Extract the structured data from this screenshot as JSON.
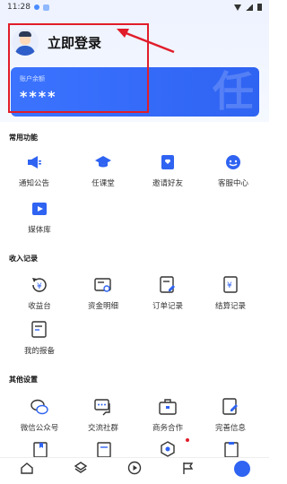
{
  "status_bar": {
    "time": "11:28"
  },
  "profile": {
    "login_label": "立即登录"
  },
  "balance": {
    "label": "账户余额",
    "value": "****",
    "watermark": "任"
  },
  "sections": {
    "common": {
      "title": "常用功能",
      "items": [
        {
          "label": "通知公告",
          "icon": "megaphone-icon"
        },
        {
          "label": "任课堂",
          "icon": "graduation-cap-icon"
        },
        {
          "label": "邀请好友",
          "icon": "invite-icon"
        },
        {
          "label": "客服中心",
          "icon": "customer-service-icon"
        },
        {
          "label": "媒体库",
          "icon": "video-folder-icon"
        }
      ]
    },
    "income": {
      "title": "收入记录",
      "items": [
        {
          "label": "收益台",
          "icon": "yuan-refresh-icon"
        },
        {
          "label": "资金明细",
          "icon": "funds-detail-icon"
        },
        {
          "label": "订单记录",
          "icon": "order-record-icon"
        },
        {
          "label": "结算记录",
          "icon": "settlement-icon"
        },
        {
          "label": "我的报备",
          "icon": "report-icon"
        }
      ]
    },
    "other": {
      "title": "其他设置",
      "items": [
        {
          "label": "微信公众号",
          "icon": "wechat-icon"
        },
        {
          "label": "交流社群",
          "icon": "chat-group-icon"
        },
        {
          "label": "商务合作",
          "icon": "briefcase-icon"
        },
        {
          "label": "完善信息",
          "icon": "edit-info-icon"
        }
      ]
    }
  },
  "tabbar": {
    "items": [
      {
        "label": "",
        "icon": "home-icon"
      },
      {
        "label": "",
        "icon": "layers-icon"
      },
      {
        "label": "",
        "icon": "play-icon"
      },
      {
        "label": "",
        "icon": "flag-icon"
      },
      {
        "label": "",
        "icon": "profile-icon"
      }
    ]
  },
  "colors": {
    "accent": "#2f63f2",
    "highlight": "#e11d2a"
  }
}
